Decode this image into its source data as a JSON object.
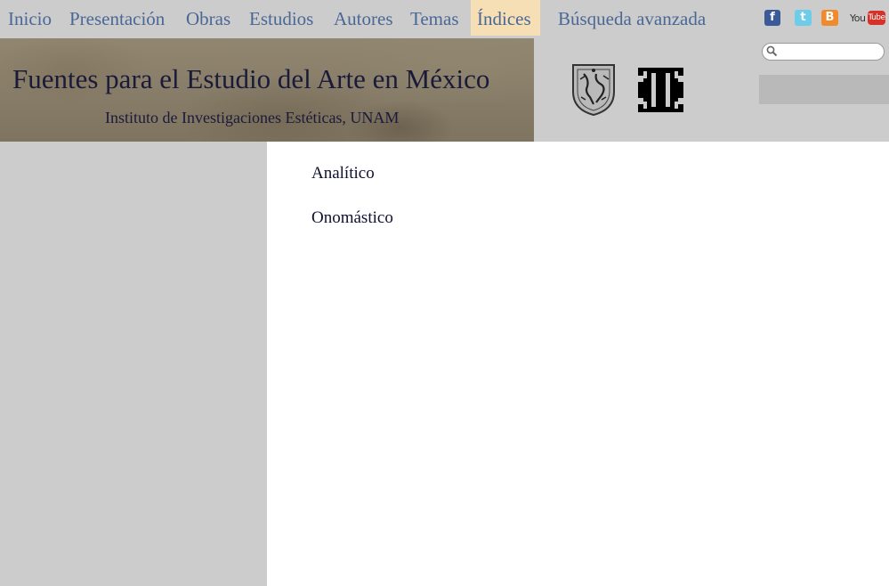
{
  "nav": {
    "items": [
      {
        "label": "Inicio",
        "active": false
      },
      {
        "label": "Presentación",
        "active": false
      },
      {
        "label": "Obras",
        "active": false
      },
      {
        "label": "Estudios",
        "active": false
      },
      {
        "label": "Autores",
        "active": false
      },
      {
        "label": "Temas",
        "active": false
      },
      {
        "label": "Índices",
        "active": true
      },
      {
        "label": "Búsqueda avanzada",
        "active": false
      }
    ],
    "social": {
      "facebook": "f",
      "twitter": "t",
      "blogger": "B",
      "youtube_you": "You",
      "youtube_tube": "Tube"
    },
    "colors": {
      "link": "#4a6896",
      "active_bg": "#f6dfb4",
      "bar_bg": "#cccccc"
    }
  },
  "header": {
    "title": "Fuentes para el Estudio del Arte en México",
    "subtitle": "Instituto de Investigaciones Estéticas, UNAM",
    "search": {
      "value": "",
      "placeholder": ""
    }
  },
  "main": {
    "index_links": [
      {
        "label": "Analítico"
      },
      {
        "label": "Onomástico"
      }
    ]
  }
}
